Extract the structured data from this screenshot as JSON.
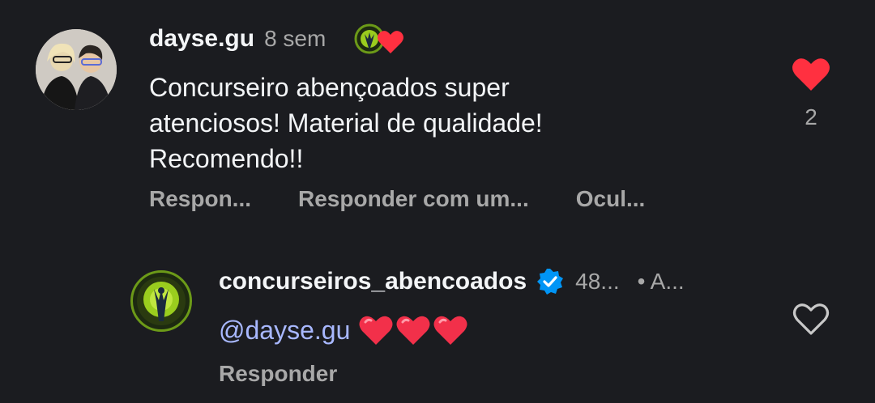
{
  "comment": {
    "username": "dayse.gu",
    "time": "8 sem",
    "text_lines": [
      "Concurseiro abençoados super",
      "atenciosos! Material de qualidade!",
      "Recomendo!!"
    ],
    "actions": [
      "Respon...",
      "Responder com um...",
      "Ocul..."
    ],
    "like_count": "2",
    "liked": true
  },
  "reply": {
    "username": "concurseiros_abencoados",
    "time": "48...",
    "extra": "• A...",
    "mention": "@dayse.gu",
    "action": "Responder",
    "liked": false
  },
  "colors": {
    "background": "#1b1c20",
    "heart_red": "#ff3040",
    "muted": "#a8a8a8",
    "mention": "#a8b8ff",
    "verified_blue": "#0095f6"
  }
}
